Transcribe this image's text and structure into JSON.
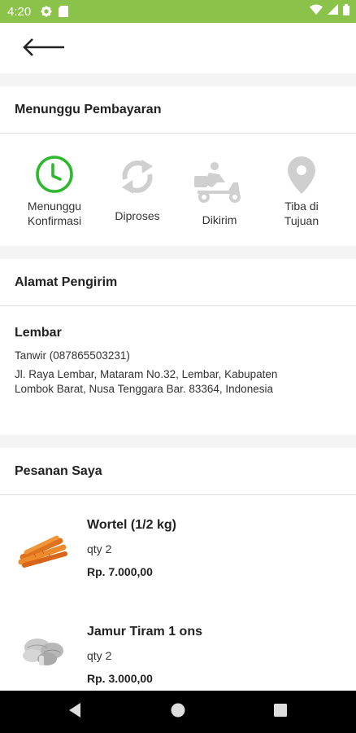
{
  "status_bar": {
    "time": "4:20",
    "icons": [
      "gear-icon",
      "sd-card-icon",
      "wifi-icon",
      "signal-icon",
      "battery-icon"
    ],
    "color": "#8bc34a"
  },
  "app_bar": {
    "back_icon": "arrow-left-icon"
  },
  "order_status": {
    "title": "Menunggu Pembayaran",
    "accent_color": "#2eb82e",
    "inactive_color": "#cfcfcf",
    "steps": [
      {
        "label": "Menunggu\nKonfirmasi",
        "icon": "clock-icon",
        "active": true
      },
      {
        "label": "Diproses",
        "icon": "refresh-icon",
        "active": false
      },
      {
        "label": "Dikirim",
        "icon": "delivery-scooter-icon",
        "active": false
      },
      {
        "label": "Tiba di\nTujuan",
        "icon": "location-pin-icon",
        "active": false
      }
    ]
  },
  "address": {
    "title": "Alamat Pengirim",
    "name": "Lembar",
    "contact": "Tanwir (087865503231)",
    "line": "Jl. Raya Lembar, Mataram No.32, Lembar, Kabupaten\nLombok Barat, Nusa Tenggara Bar. 83364, Indonesia"
  },
  "orders": {
    "title": "Pesanan Saya",
    "items": [
      {
        "name": "Wortel (1/2 kg)",
        "qty": "qty 2",
        "price": "Rp. 7.000,00",
        "image": "carrot-image"
      },
      {
        "name": "Jamur Tiram 1 ons",
        "qty": "qty 2",
        "price": "Rp. 3.000,00",
        "image": "oyster-mushroom-image"
      }
    ]
  },
  "nav_bar": {
    "buttons": [
      "back-triangle-icon",
      "home-circle-icon",
      "recents-square-icon"
    ]
  }
}
